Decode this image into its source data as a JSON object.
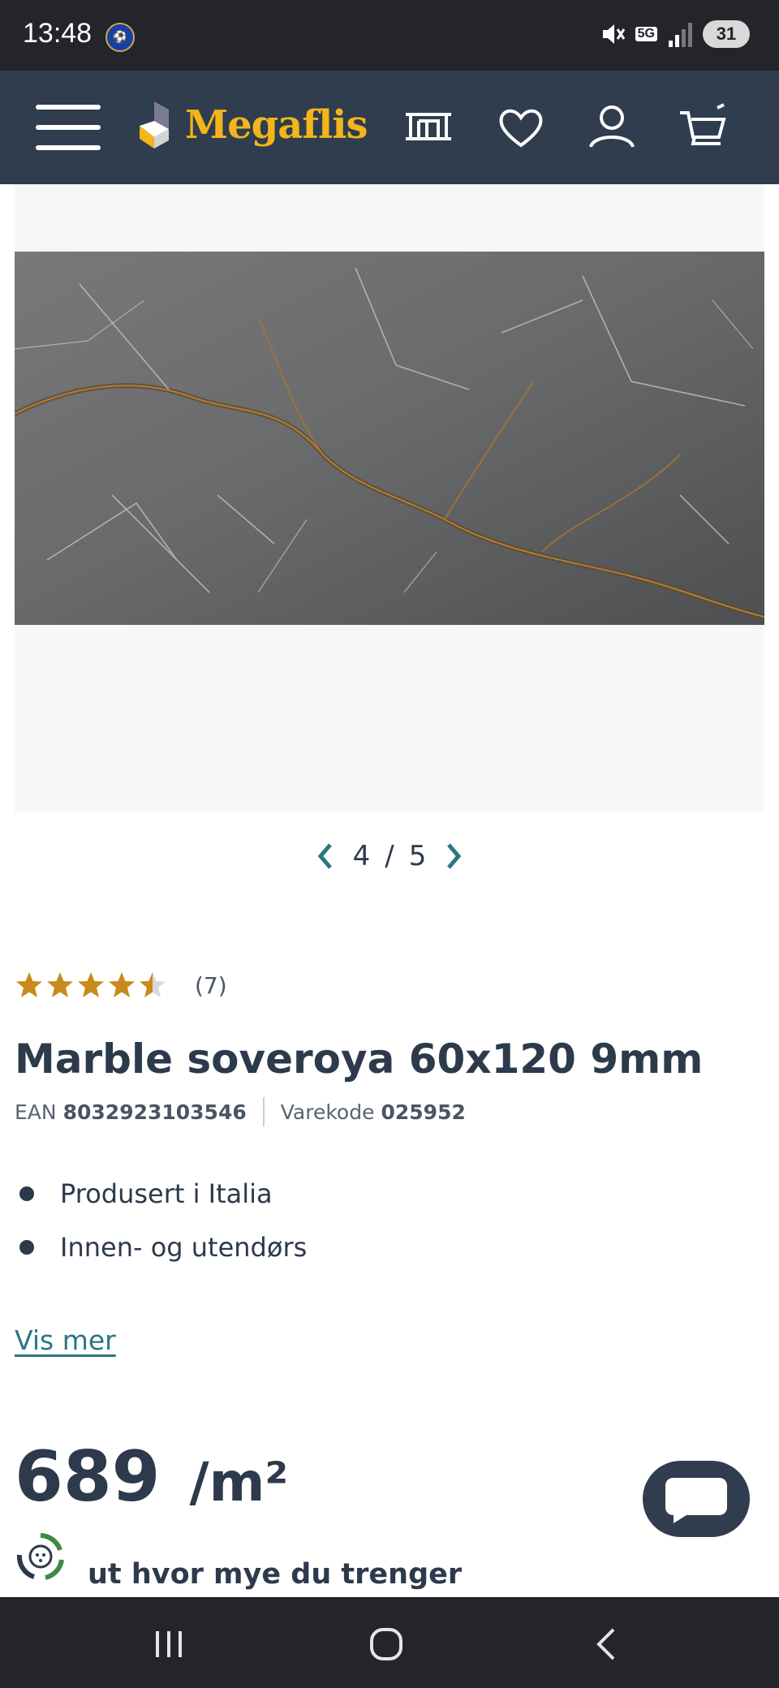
{
  "status_bar": {
    "time": "13:48",
    "network": "5G",
    "battery": "31"
  },
  "header": {
    "logo_text": "Megaflis",
    "icons": [
      "menu-icon",
      "store-icon",
      "heart-icon",
      "user-icon",
      "cart-icon"
    ]
  },
  "gallery": {
    "current": "4",
    "separator": "/",
    "total": "5",
    "image": "grey marble tile with gold veins"
  },
  "product": {
    "rating": 4.5,
    "review_count": "(7)",
    "title": "Marble soveroya 60x120 9mm",
    "ean_label": "EAN",
    "ean_value": "8032923103546",
    "sku_label": "Varekode",
    "sku_value": "025952",
    "features": [
      "Produsert i Italia",
      "Innen- og utendørs"
    ],
    "show_more": "Vis mer",
    "price_value": "689",
    "price_unit": "/m²",
    "calculator_text": "ut hvor mye du trenger"
  },
  "colors": {
    "header_bg": "#2f3d4e",
    "logo": "#f3b51b",
    "star": "#c98a1c",
    "link": "#2c7583",
    "text": "#2c3a4b"
  }
}
